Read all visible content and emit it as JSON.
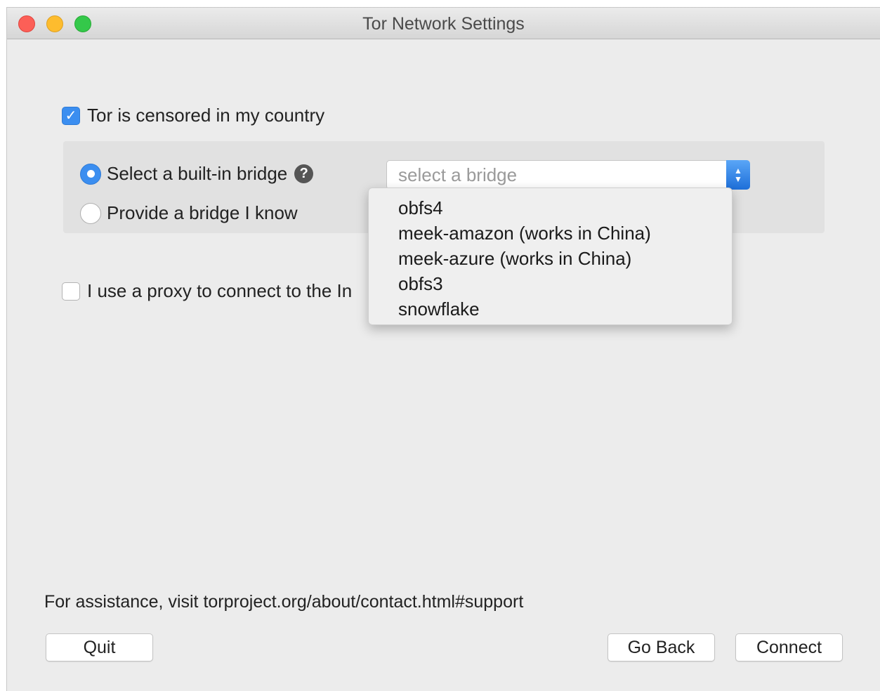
{
  "window": {
    "title": "Tor Network Settings"
  },
  "censored": {
    "label": "Tor is censored in my country",
    "checked": true
  },
  "bridge": {
    "builtin_label": "Select a built-in bridge",
    "builtin_selected": true,
    "help_glyph": "?",
    "provide_label": "Provide a bridge I know",
    "select_placeholder": "select a bridge",
    "options": [
      "obfs4",
      "meek-amazon (works in China)",
      "meek-azure (works in China)",
      "obfs3",
      "snowflake"
    ]
  },
  "proxy": {
    "label": "I use a proxy to connect to the In",
    "checked": false
  },
  "footer": {
    "assistance": "For assistance, visit torproject.org/about/contact.html#support",
    "quit": "Quit",
    "go_back": "Go Back",
    "connect": "Connect"
  },
  "colors": {
    "accent": "#3b8ef0",
    "close": "#fc5f57",
    "minimize": "#fdbc2e",
    "maximize": "#34c84a"
  }
}
